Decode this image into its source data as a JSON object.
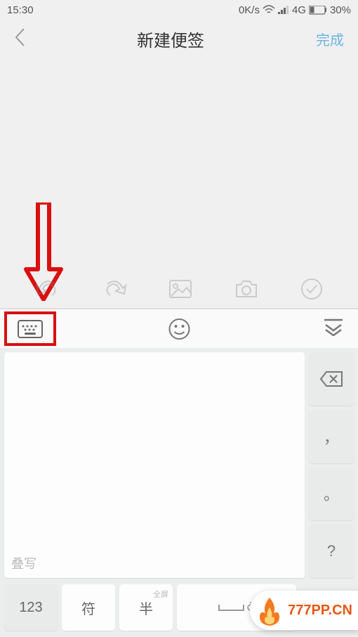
{
  "status": {
    "time": "15:30",
    "speed": "0K/s",
    "network": "4G",
    "battery": "30%"
  },
  "nav": {
    "title": "新建便签",
    "done": "完成"
  },
  "ime": {
    "hint": "叠写",
    "side": {
      "backspace": "⌫",
      "comma": "，",
      "period": "。",
      "question": "?"
    },
    "bottom": {
      "num": "123",
      "sym": "符",
      "half": "半",
      "half_sub": "全屏"
    }
  },
  "watermark": "777PP.CN"
}
